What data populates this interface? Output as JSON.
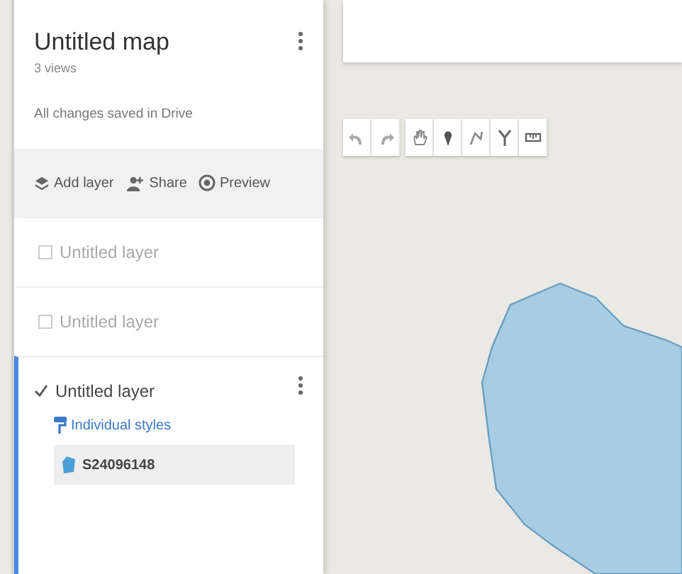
{
  "map": {
    "title": "Untitled map",
    "views": "3 views",
    "save_status": "All changes saved in Drive"
  },
  "actions": [
    {
      "kind": "layers",
      "label": "Add layer"
    },
    {
      "kind": "share",
      "label": "Share"
    },
    {
      "kind": "preview",
      "label": "Preview"
    }
  ],
  "layers": [
    {
      "name": "Untitled layer",
      "checked": false,
      "selected": false
    },
    {
      "name": "Untitled layer",
      "checked": false,
      "selected": false
    },
    {
      "name": "Untitled layer",
      "checked": true,
      "selected": true,
      "style_label": "Individual styles",
      "feature": "S24096148"
    }
  ],
  "map_tools": [
    {
      "kind": "undo"
    },
    {
      "kind": "redo"
    },
    {
      "kind": "hand"
    },
    {
      "kind": "marker"
    },
    {
      "kind": "line"
    },
    {
      "kind": "route"
    },
    {
      "kind": "ruler"
    }
  ]
}
